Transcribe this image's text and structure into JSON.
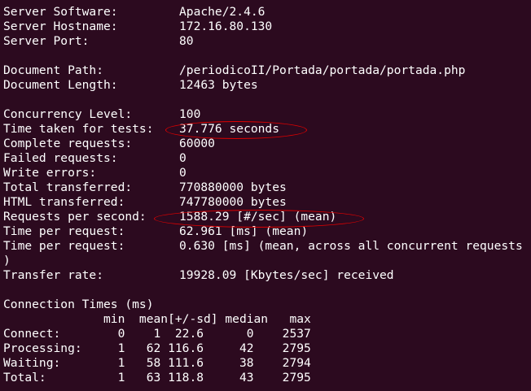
{
  "terminal": {
    "server_software": {
      "label": "Server Software:",
      "value": "Apache/2.4.6"
    },
    "server_hostname": {
      "label": "Server Hostname:",
      "value": "172.16.80.130"
    },
    "server_port": {
      "label": "Server Port:",
      "value": "80"
    },
    "document_path": {
      "label": "Document Path:",
      "value": "/periodicoII/Portada/portada/portada.php"
    },
    "document_length": {
      "label": "Document Length:",
      "value": "12463 bytes"
    },
    "concurrency_level": {
      "label": "Concurrency Level:",
      "value": "100"
    },
    "time_taken": {
      "label": "Time taken for tests:",
      "value": "37.776 seconds"
    },
    "complete_requests": {
      "label": "Complete requests:",
      "value": "60000"
    },
    "failed_requests": {
      "label": "Failed requests:",
      "value": "0"
    },
    "write_errors": {
      "label": "Write errors:",
      "value": "0"
    },
    "total_transferred": {
      "label": "Total transferred:",
      "value": "770880000 bytes"
    },
    "html_transferred": {
      "label": "HTML transferred:",
      "value": "747780000 bytes"
    },
    "requests_per_second": {
      "label": "Requests per second:",
      "value": "1588.29 [#/sec] (mean)"
    },
    "time_per_request_1": {
      "label": "Time per request:",
      "value": "62.961 [ms] (mean)"
    },
    "time_per_request_2": {
      "label": "Time per request:",
      "value": "0.630 [ms] (mean, across all concurrent requests"
    },
    "wrap_paren": ")",
    "transfer_rate": {
      "label": "Transfer rate:",
      "value": "19928.09 [Kbytes/sec] received"
    },
    "connection_times_title": "Connection Times (ms)",
    "connection_header": "              min  mean[+/-sd] median   max",
    "connection_rows": [
      "Connect:        0    1  22.6      0    2537",
      "Processing:     1   62 116.6     42    2795",
      "Waiting:        1   58 111.6     38    2794",
      "Total:          1   63 118.8     43    2795"
    ]
  },
  "colors": {
    "background": "#2c0a1f",
    "foreground": "#ffffff",
    "annotation": "#e00000"
  }
}
